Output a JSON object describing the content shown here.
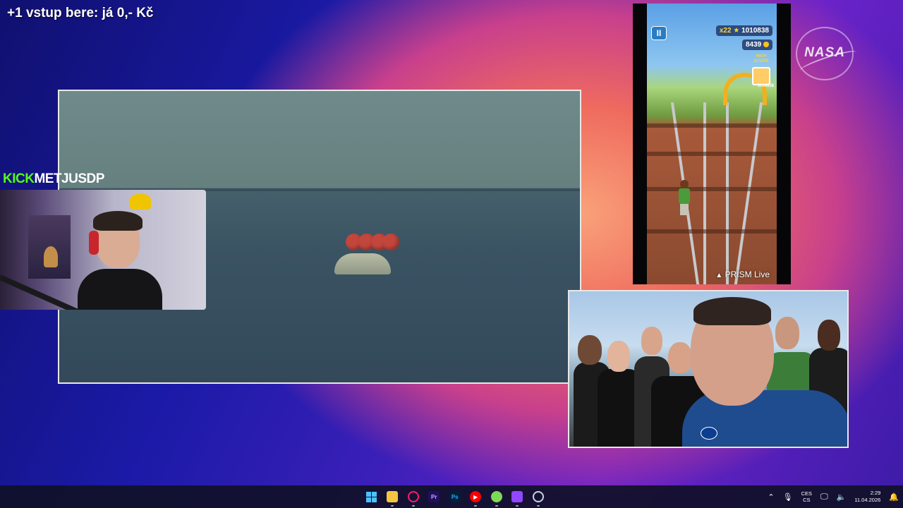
{
  "overlay": {
    "title": "+1 vstup bere: já 0,- Kč",
    "kick_prefix": "KICK",
    "kick_channel": "METJUSDP",
    "nasa_logo": "NASA"
  },
  "game": {
    "pause_icon": "pause-icon",
    "multiplier": "x22",
    "score": "1010838",
    "coins": "8439",
    "high_score_label": "HIGH SCORE",
    "high_score": "5104338",
    "prism_label": "PRISM Live"
  },
  "taskbar": {
    "apps": [
      {
        "name": "start-button",
        "icon": "windows-icon",
        "color": "#4cc2ff"
      },
      {
        "name": "file-explorer",
        "icon": "folder-icon",
        "color": "#f5c542"
      },
      {
        "name": "opera-gx",
        "icon": "opera-icon",
        "color": "#ff1b6b"
      },
      {
        "name": "premiere-pro",
        "icon": "premiere-icon",
        "label": "Pr",
        "color": "#1f0f5c"
      },
      {
        "name": "photoshop",
        "icon": "photoshop-icon",
        "label": "Ps",
        "color": "#001e36"
      },
      {
        "name": "youtube-music",
        "icon": "youtube-music-icon",
        "color": "#ff0000"
      },
      {
        "name": "chat-app",
        "icon": "chat-icon",
        "color": "#7ed957"
      },
      {
        "name": "twitch",
        "icon": "twitch-icon",
        "color": "#9146ff"
      },
      {
        "name": "steam-app",
        "icon": "steam-icon",
        "color": "#c7d5e0"
      }
    ],
    "language_top": "CES",
    "language_bottom": "CS",
    "time": "2:29",
    "date": "11.04.2026"
  }
}
